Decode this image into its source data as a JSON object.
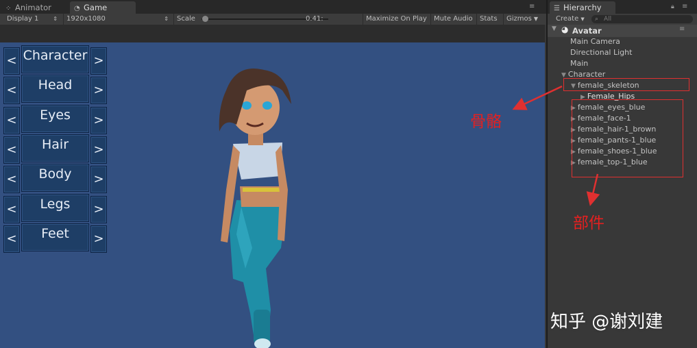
{
  "tabs": {
    "animator": "Animator",
    "game": "Game",
    "hierarchy": "Hierarchy"
  },
  "game_toolbar": {
    "display": "Display 1",
    "resolution": "1920x1080",
    "scale_label": "Scale",
    "scale_value": "0.41:",
    "scale_fraction": 0.02,
    "maximize": "Maximize On Play",
    "mute": "Mute Audio",
    "stats": "Stats",
    "gizmos": "Gizmos"
  },
  "customizer": {
    "prev": "<",
    "next": ">",
    "rows": [
      "Character",
      "Head",
      "Eyes",
      "Hair",
      "Body",
      "Legs",
      "Feet"
    ]
  },
  "hierarchy": {
    "create": "Create",
    "search_placeholder": "All",
    "scene_name": "Avatar",
    "items": [
      {
        "label": "Main Camera",
        "indent": 0,
        "arrow": ""
      },
      {
        "label": "Directional Light",
        "indent": 0,
        "arrow": ""
      },
      {
        "label": "Main",
        "indent": 0,
        "arrow": ""
      },
      {
        "label": "Character",
        "indent": 0,
        "arrow": "▼"
      },
      {
        "label": "female_skeleton",
        "indent": 1,
        "arrow": "▼"
      },
      {
        "label": "Female_Hips",
        "indent": 2,
        "arrow": "▶"
      },
      {
        "label": "female_eyes_blue",
        "indent": 1,
        "arrow": "▶"
      },
      {
        "label": "female_face-1",
        "indent": 1,
        "arrow": "▶"
      },
      {
        "label": "female_hair-1_brown",
        "indent": 1,
        "arrow": "▶"
      },
      {
        "label": "female_pants-1_blue",
        "indent": 1,
        "arrow": "▶"
      },
      {
        "label": "female_shoes-1_blue",
        "indent": 1,
        "arrow": "▶"
      },
      {
        "label": "female_top-1_blue",
        "indent": 1,
        "arrow": "▶"
      }
    ]
  },
  "annotations": {
    "skeleton": "骨骼",
    "parts": "部件",
    "watermark": "知乎 @谢刘建"
  },
  "colors": {
    "scene_bg": "#335081",
    "annotation_red": "#e03030"
  }
}
